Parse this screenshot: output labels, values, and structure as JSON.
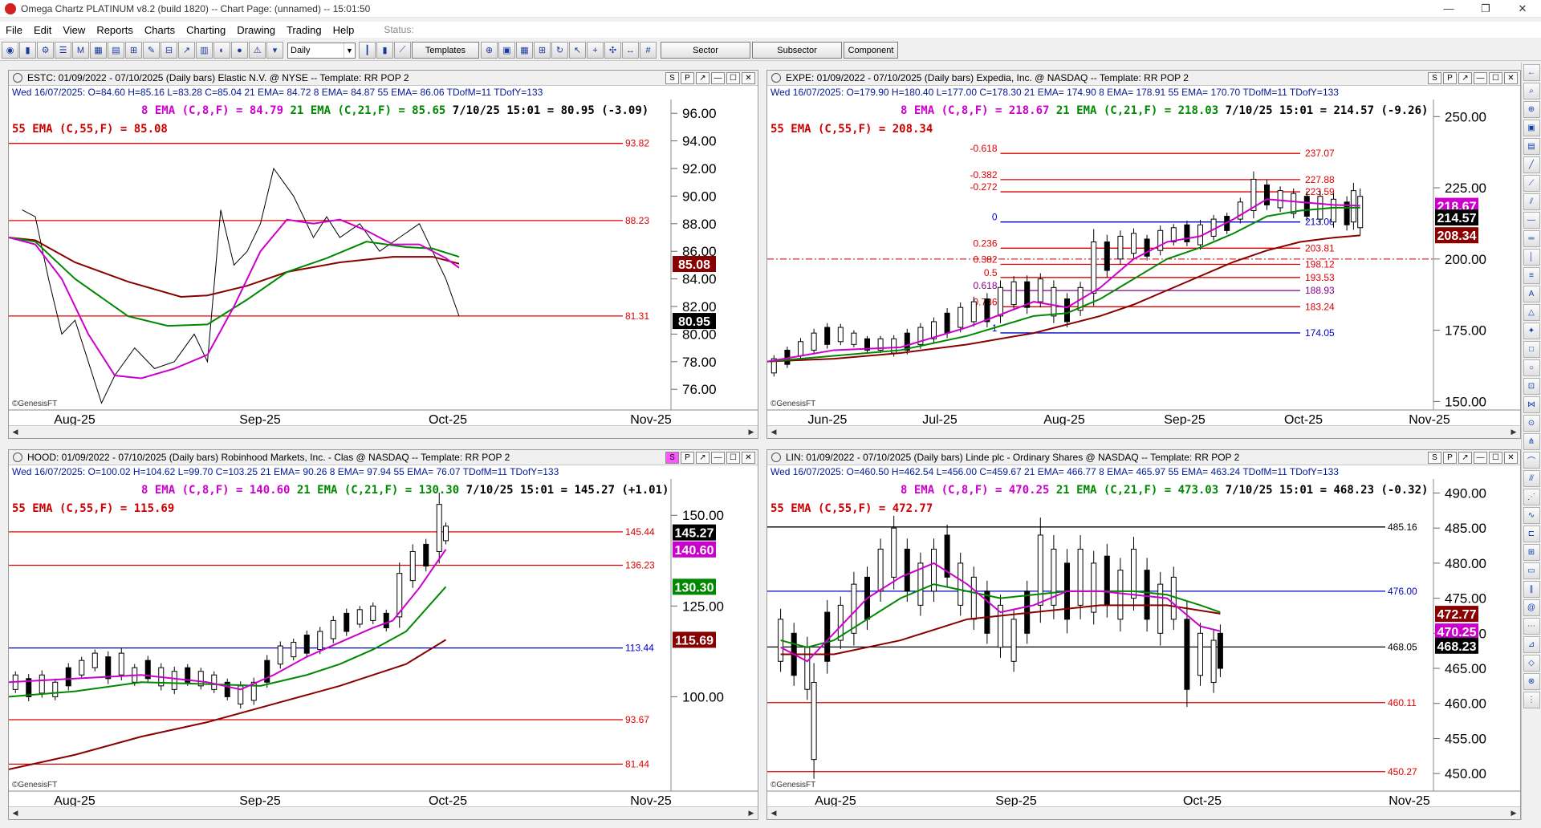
{
  "window": {
    "title": "Omega Chartz PLATINUM v8.2 (build 1820)  --  Chart Page: (unnamed)  --  15:01:50",
    "controls": [
      "—",
      "❐",
      "✕"
    ]
  },
  "menu": {
    "items": [
      "File",
      "Edit",
      "View",
      "Reports",
      "Charts",
      "Charting",
      "Drawing",
      "Trading",
      "Help"
    ],
    "status_label": "Status:"
  },
  "toolbar": {
    "period_select": "Daily",
    "templates_label": "Templates",
    "sector_label": "Sector",
    "subsector_label": "Subsector",
    "component_label": "Component"
  },
  "panels": [
    {
      "id": "estc",
      "title": "ESTC: 01/09/2022 - 07/10/2025 (Daily bars)  Elastic N.V. @ NYSE  --  Template: RR POP 2",
      "info": "Wed  16/07/2025:  O=84.60  H=85.16  L=83.28  C=85.04  21 EMA= 84.72  8 EMA= 84.87  55 EMA= 86.06  TDofM=11  TDofY=133",
      "legend_line1": {
        "ema8": "8 EMA (C,8,F) = 84.79",
        "ema21": "21 EMA (C,21,F) = 85.65",
        "last": "7/10/25 15:01 = 80.95 (-3.09)"
      },
      "legend_line2": "55 EMA (C,55,F) = 85.08",
      "watermark": "©GenesisFT",
      "x_labels": [
        "Aug-25",
        "Sep-25",
        "Oct-25",
        "Nov-25"
      ],
      "y_ticks": [
        "96.00",
        "94.00",
        "92.00",
        "90.00",
        "88.00",
        "86.00",
        "84.00",
        "82.00",
        "80.00",
        "78.00",
        "76.00"
      ],
      "levels": [
        "93.82",
        "88.23",
        "81.31"
      ],
      "price_tags": {
        "ema55": "85.08",
        "last": "80.95"
      },
      "buttons": [
        "S",
        "P",
        "↗",
        "—",
        "☐",
        "✕"
      ]
    },
    {
      "id": "expe",
      "title": "EXPE: 01/09/2022 - 07/10/2025 (Daily bars)  Expedia, Inc. @ NASDAQ  --  Template: RR POP 2",
      "info": "Wed  16/07/2025:  O=179.90  H=180.40  L=177.00  C=178.30  21 EMA= 174.90  8 EMA= 178.91  55 EMA= 170.70  TDofM=11  TDofY=133",
      "legend_line1": {
        "ema8": "8 EMA (C,8,F) = 218.67",
        "ema21": "21 EMA (C,21,F) = 218.03",
        "last": "7/10/25 15:01 = 214.57 (-9.26)"
      },
      "legend_line2": "55 EMA (C,55,F) = 208.34",
      "watermark": "©GenesisFT",
      "x_labels": [
        "Jun-25",
        "Jul-25",
        "Aug-25",
        "Sep-25",
        "Oct-25",
        "Nov-25"
      ],
      "y_ticks": [
        "250.00",
        "225.00",
        "200.00",
        "175.00",
        "150.00"
      ],
      "fib_left": [
        "-0.618",
        "-0.382",
        "-0.272",
        "0",
        "0.236",
        "0.382",
        "0.5",
        "0.618",
        "0.786",
        "1"
      ],
      "fib_right": [
        "237.07",
        "227.88",
        "223.59",
        "213.00",
        "203.81",
        "198.12",
        "193.53",
        "188.93",
        "183.24",
        "174.05"
      ],
      "price_tags": {
        "ema8": "218.67",
        "last": "214.57",
        "ema55": "208.34"
      },
      "buttons": [
        "S",
        "P",
        "↗",
        "—",
        "☐",
        "✕"
      ]
    },
    {
      "id": "hood",
      "title": "HOOD: 01/09/2022 - 07/10/2025 (Daily bars)  Robinhood Markets, Inc. - Clas @ NASDAQ  --  Template: RR POP 2",
      "info": "Wed  16/07/2025:  O=100.02  H=104.62  L=99.70  C=103.25  21 EMA= 90.26  8 EMA= 97.94  55 EMA= 76.07  TDofM=11  TDofY=133",
      "legend_line1": {
        "ema8": "8 EMA (C,8,F) = 140.60",
        "ema21": "21 EMA (C,21,F) = 130.30",
        "last": "7/10/25 15:01 = 145.27 (+1.01)"
      },
      "legend_line2": "55 EMA (C,55,F) = 115.69",
      "watermark": "©GenesisFT",
      "x_labels": [
        "Aug-25",
        "Sep-25",
        "Oct-25",
        "Nov-25"
      ],
      "y_ticks": [
        "150.00",
        "125.00",
        "100.00"
      ],
      "levels": [
        "145.44",
        "136.23",
        "113.44",
        "93.67",
        "81.44"
      ],
      "price_tags": {
        "last": "145.27",
        "ema8": "140.60",
        "ema21": "130.30",
        "ema55": "115.69"
      },
      "buttons": [
        "S",
        "P",
        "↗",
        "—",
        "☐",
        "✕"
      ]
    },
    {
      "id": "lin",
      "title": "LIN: 01/09/2022 - 07/10/2025 (Daily bars)  Linde plc - Ordinary Shares @ NASDAQ  --  Template: RR POP 2",
      "info": "Wed  16/07/2025:  O=460.50  H=462.54  L=456.00  C=459.67  21 EMA= 466.77  8 EMA= 465.97  55 EMA= 463.24  TDofM=11  TDofY=133",
      "legend_line1": {
        "ema8": "8 EMA (C,8,F) = 470.25",
        "ema21": "21 EMA (C,21,F) = 473.03",
        "last": "7/10/25 15:01 = 468.23 (-0.32)"
      },
      "legend_line2": "55 EMA (C,55,F) = 472.77",
      "watermark": "©GenesisFT",
      "x_labels": [
        "Aug-25",
        "Sep-25",
        "Oct-25",
        "Nov-25"
      ],
      "y_ticks": [
        "490.00",
        "485.00",
        "480.00",
        "475.00",
        "470.00",
        "465.00",
        "460.00",
        "455.00",
        "450.00"
      ],
      "levels": [
        "485.16",
        "476.00",
        "468.05",
        "460.11",
        "450.27"
      ],
      "price_tags": {
        "ema55": "472.77",
        "ema8": "470.25",
        "last": "468.23"
      },
      "buttons": [
        "S",
        "P",
        "↗",
        "—",
        "☐",
        "✕"
      ]
    }
  ],
  "colors": {
    "ema8": "#cc00cc",
    "ema21": "#008800",
    "ema55": "#880000",
    "support_resistance": "#dd0000",
    "pivot": "#0000cc"
  }
}
